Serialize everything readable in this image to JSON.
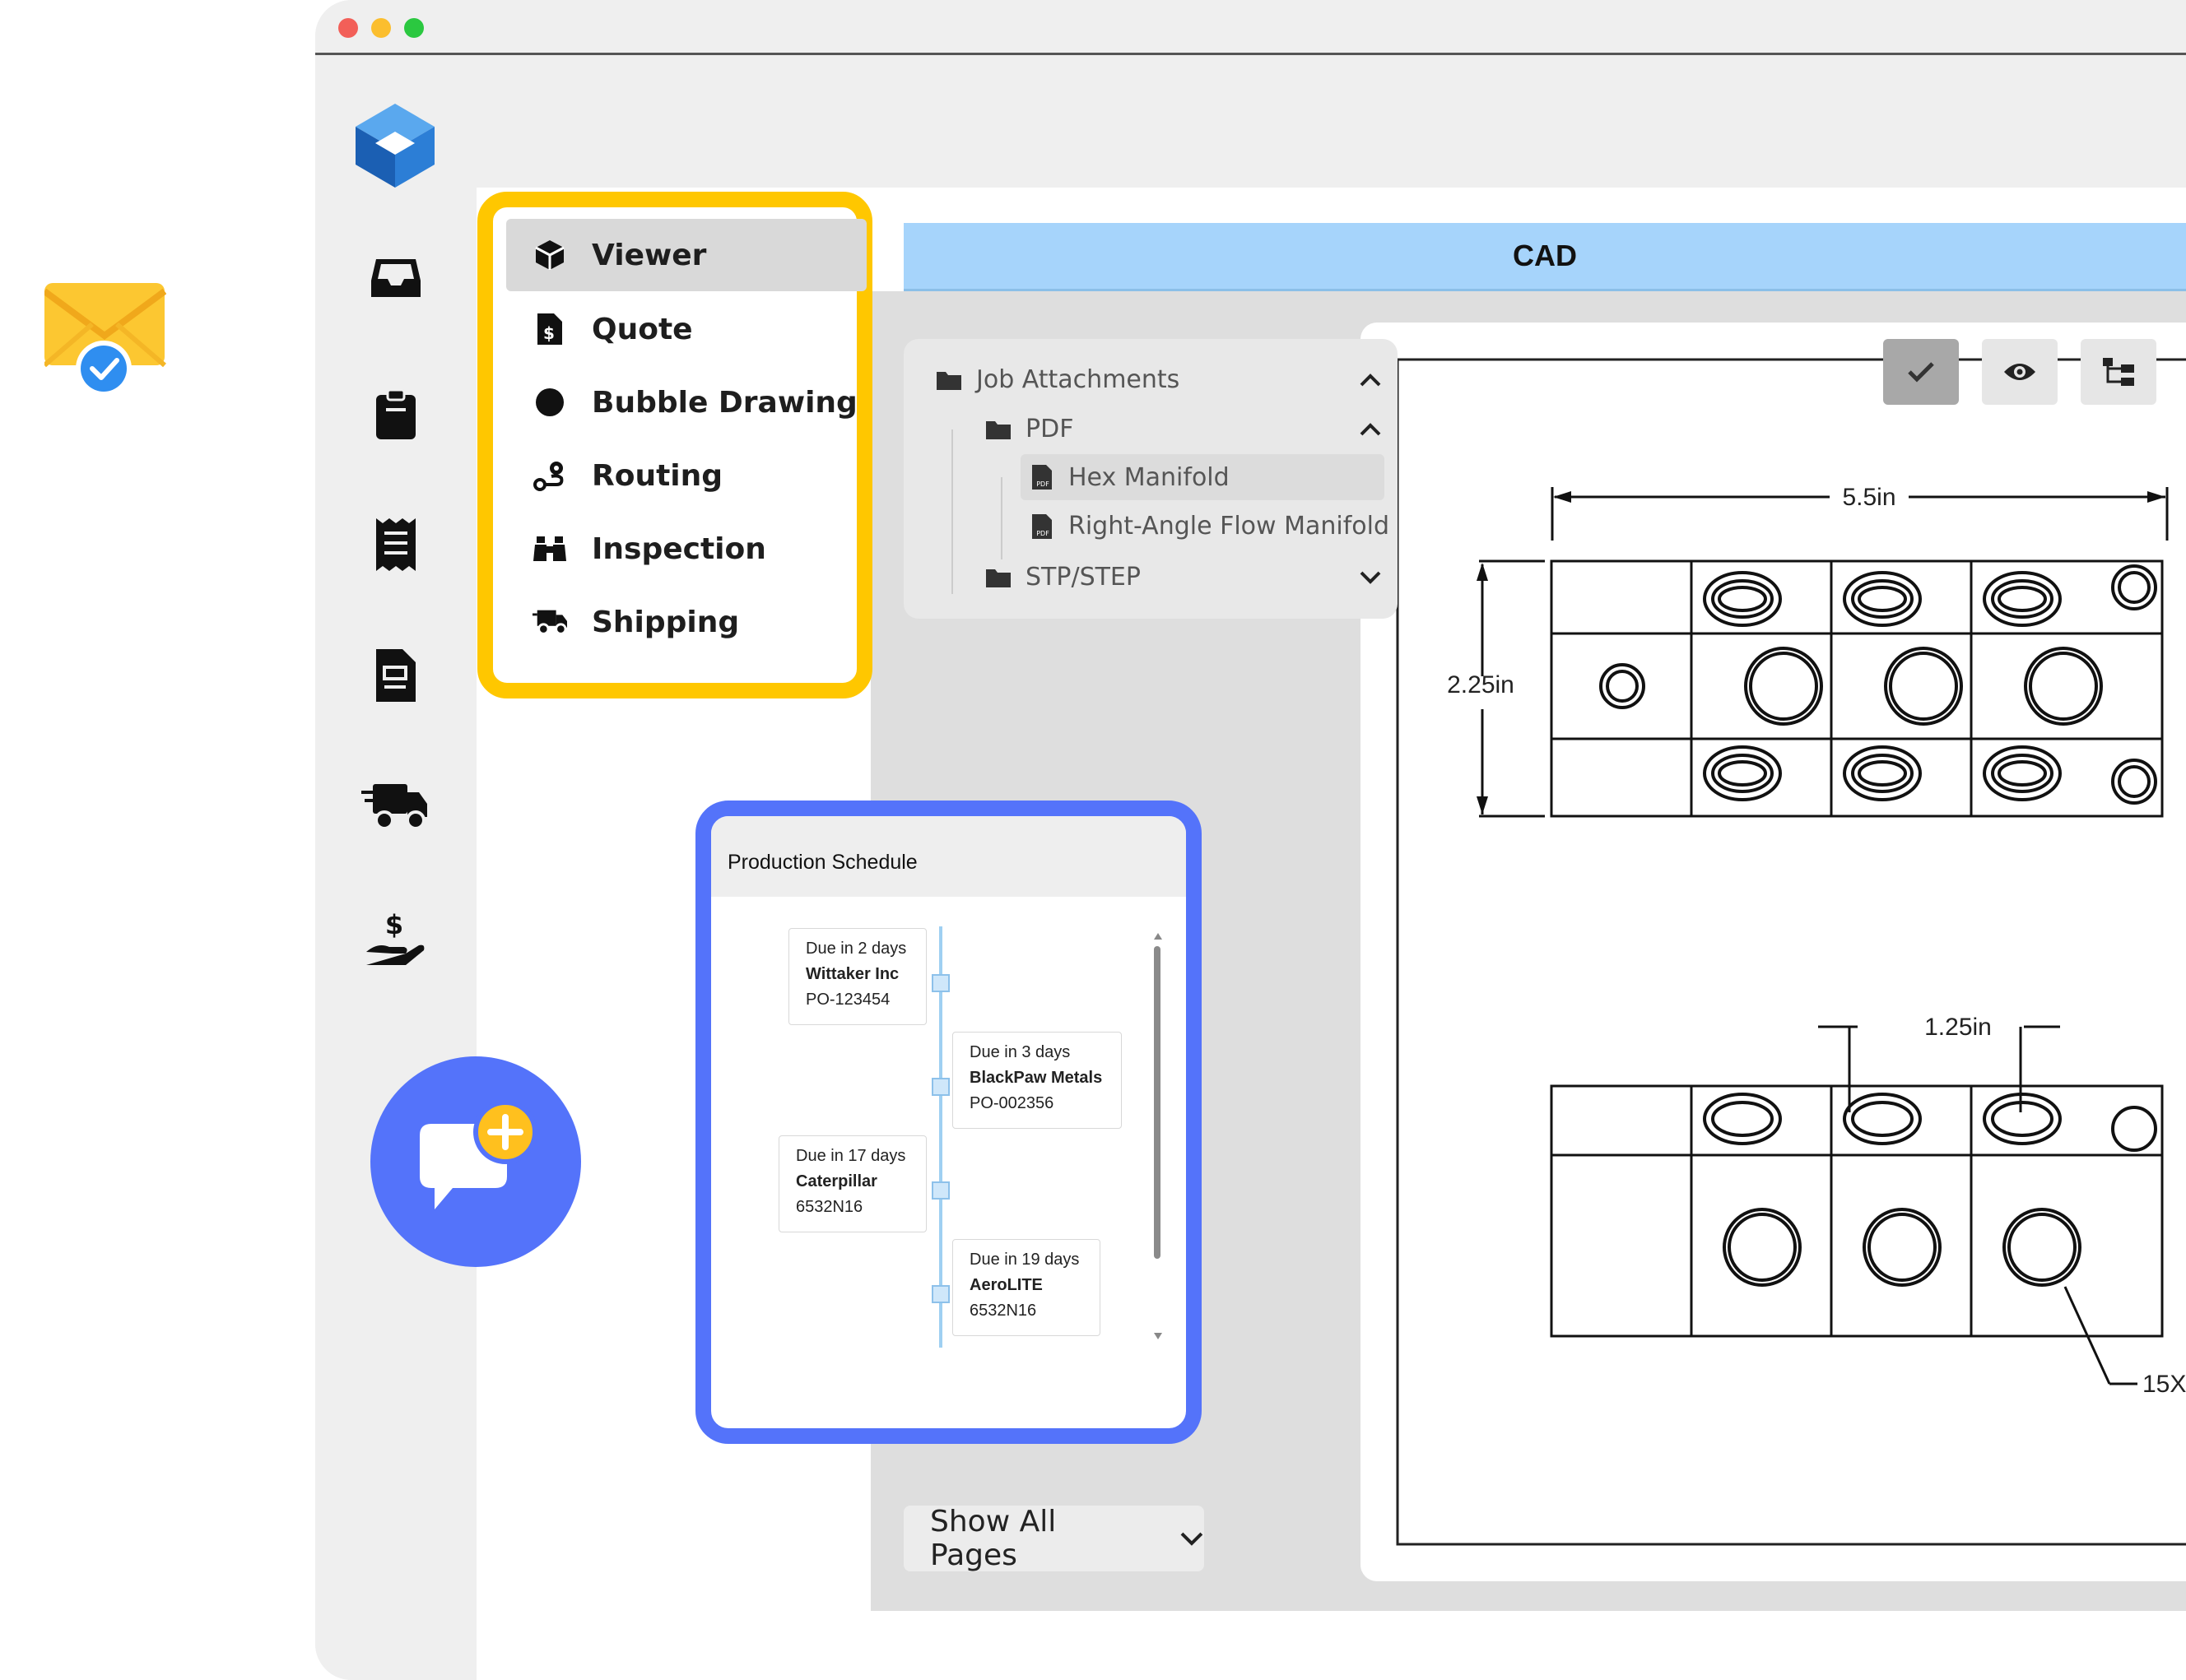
{
  "nav": {
    "items": [
      {
        "label": "Viewer",
        "icon": "cube-icon",
        "active": true
      },
      {
        "label": "Quote",
        "icon": "dollar-file-icon",
        "active": false
      },
      {
        "label": "Bubble Drawing",
        "icon": "circle-icon",
        "active": false
      },
      {
        "label": "Routing",
        "icon": "route-icon",
        "active": false
      },
      {
        "label": "Inspection",
        "icon": "binoculars-icon",
        "active": false
      },
      {
        "label": "Shipping",
        "icon": "truck-icon",
        "active": false
      }
    ]
  },
  "cad": {
    "header": "CAD"
  },
  "attachments": {
    "root": "Job Attachments",
    "pdf_folder": "PDF",
    "files": [
      "Hex Manifold",
      "Right-Angle Flow Manifold"
    ],
    "step_folder": "STP/STEP"
  },
  "drawing": {
    "dim_width": "5.5in",
    "dim_height": "2.25in",
    "dim_pitch": "1.25in",
    "callout": "15X"
  },
  "schedule": {
    "title": "Production Schedule",
    "entries": [
      {
        "due": "Due in 2 days",
        "customer": "Wittaker Inc",
        "po": "PO-123454"
      },
      {
        "due": "Due in 3 days",
        "customer": "BlackPaw Metals",
        "po": "PO-002356"
      },
      {
        "due": "Due in 17 days",
        "customer": "Caterpillar",
        "po": "6532N16"
      },
      {
        "due": "Due in 19 days",
        "customer": "AeroLITE",
        "po": "6532N16"
      }
    ]
  },
  "pages": {
    "show_all_label": "Show All Pages"
  },
  "colors": {
    "accent_yellow": "#ffc700",
    "accent_blue": "#5473fa",
    "cad_header": "#a6d4fb"
  }
}
